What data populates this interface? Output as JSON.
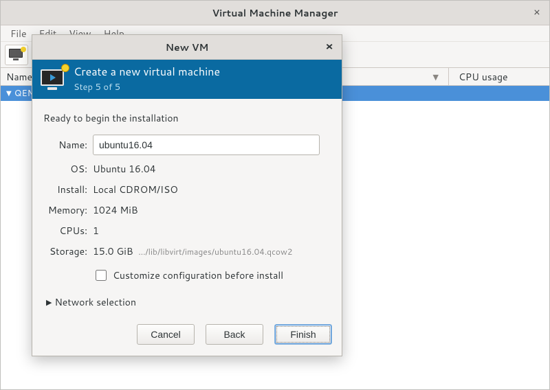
{
  "window": {
    "title": "Virtual Machine Manager"
  },
  "menubar": {
    "file": "File",
    "edit": "Edit",
    "view": "View",
    "help": "Help"
  },
  "columns": {
    "name": "Name",
    "cpu": "CPU usage"
  },
  "list": {
    "row0": "QEMU"
  },
  "dialog": {
    "title": "New VM",
    "banner_title": "Create a new virtual machine",
    "banner_step": "Step 5 of 5",
    "ready": "Ready to begin the installation",
    "labels": {
      "name": "Name:",
      "os": "OS:",
      "install": "Install:",
      "memory": "Memory:",
      "cpus": "CPUs:",
      "storage": "Storage:"
    },
    "values": {
      "name": "ubuntu16.04",
      "os": "Ubuntu 16.04",
      "install": "Local CDROM/ISO",
      "memory": "1024 MiB",
      "cpus": "1",
      "storage_size": "15.0 GiB",
      "storage_path": ".../lib/libvirt/images/ubuntu16.04.qcow2"
    },
    "customize": "Customize configuration before install",
    "network": "Network selection",
    "buttons": {
      "cancel": "Cancel",
      "back": "Back",
      "finish": "Finish"
    }
  }
}
